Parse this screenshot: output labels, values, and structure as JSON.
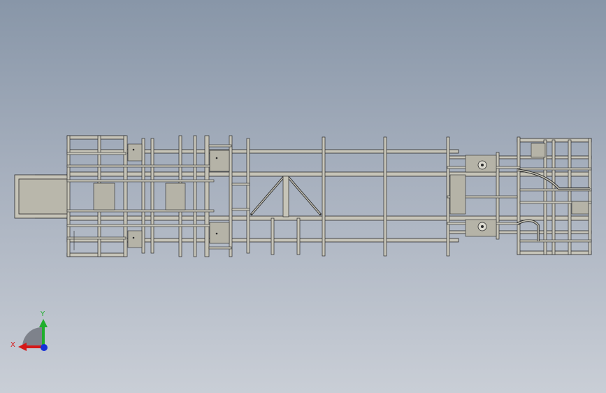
{
  "viewport": {
    "background_top": "#8896a8",
    "background_bottom": "#c9ced6"
  },
  "model": {
    "line_color": "#2a2a2a",
    "fill_color": "#b3b1a5",
    "part_fill": "#c9c7bc"
  },
  "triad": {
    "x_label": "X",
    "y_label": "Y",
    "x_color": "#d61818",
    "y_color": "#1fae2c",
    "z_color": "#1530d8",
    "arc_color": "#6d7079"
  }
}
